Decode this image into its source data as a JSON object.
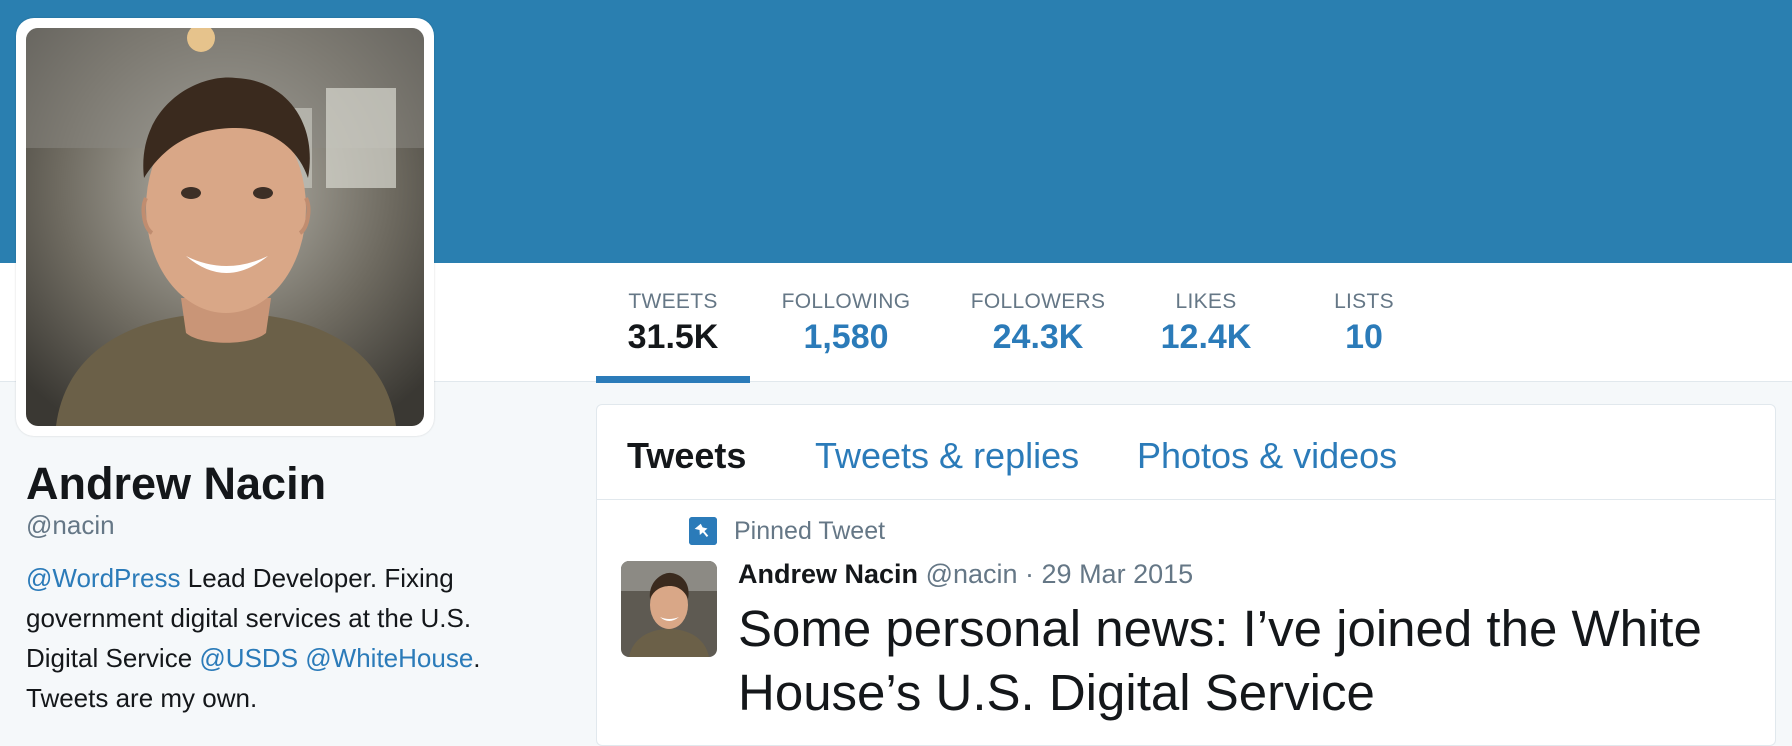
{
  "profile": {
    "name": "Andrew Nacin",
    "handle": "@nacin",
    "bio": {
      "link1": "@WordPress",
      "text1": " Lead Developer. Fixing government digital services at the U.S. Digital Service ",
      "link2": "@USDS",
      "space": " ",
      "link3": "@WhiteHouse",
      "text2": ". Tweets are my own."
    }
  },
  "stats": [
    {
      "label": "TWEETS",
      "value": "31.5K"
    },
    {
      "label": "FOLLOWING",
      "value": "1,580"
    },
    {
      "label": "FOLLOWERS",
      "value": "24.3K"
    },
    {
      "label": "LIKES",
      "value": "12.4K"
    },
    {
      "label": "LISTS",
      "value": "10"
    }
  ],
  "tabs": [
    "Tweets",
    "Tweets & replies",
    "Photos & videos"
  ],
  "pinned_tweet": {
    "label": "Pinned Tweet",
    "author_name": "Andrew Nacin",
    "author_handle": "@nacin",
    "separator": " · ",
    "date": "29 Mar 2015",
    "text": "Some personal news: I’ve joined the White House’s U.S. Digital Service"
  },
  "colors": {
    "banner": "#2a7fb0",
    "link": "#2b7bb9",
    "muted": "#657786",
    "text": "#14171a"
  },
  "icons": [
    "pin-icon"
  ]
}
